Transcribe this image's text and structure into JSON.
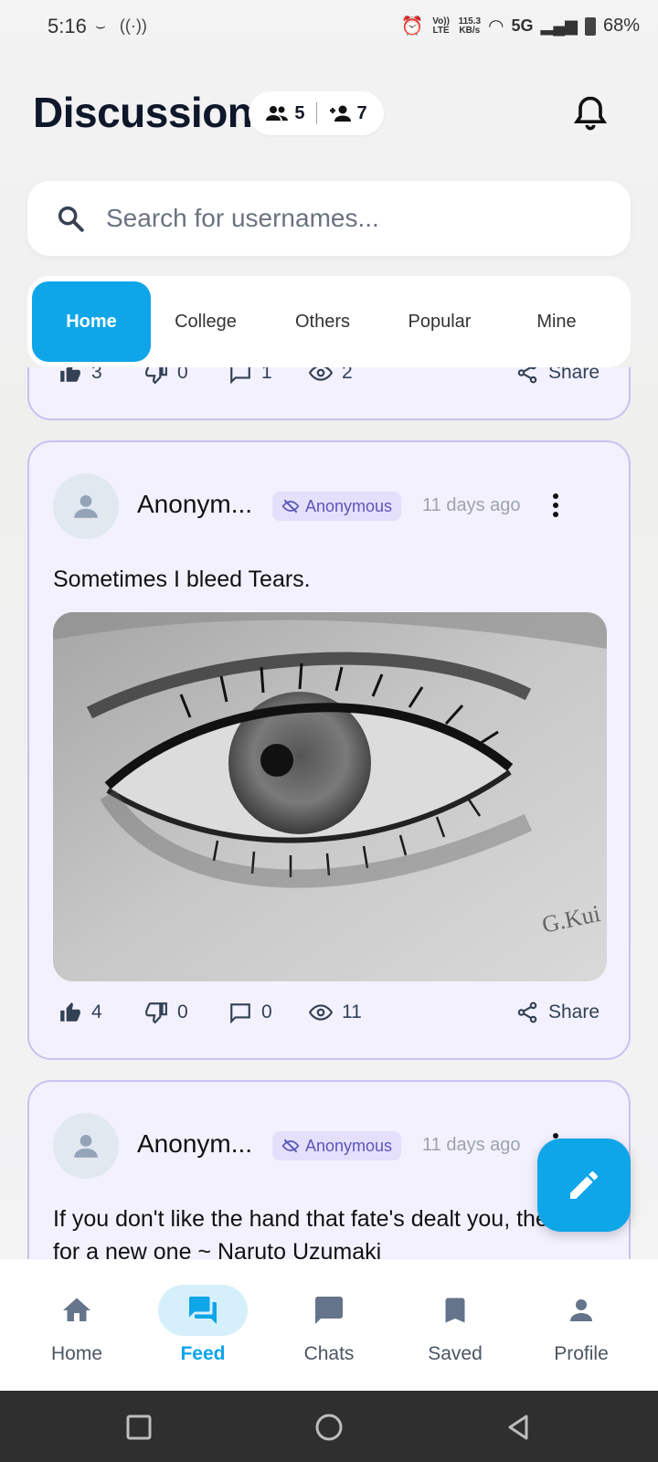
{
  "status_bar": {
    "time": "5:16",
    "network_speed_value": "115.3",
    "network_speed_unit": "KB/s",
    "volte": "Vo)) LTE",
    "network_type": "5G",
    "battery": "68%"
  },
  "header": {
    "title": "Discussion",
    "members_count": "5",
    "friends_count": "7"
  },
  "search": {
    "placeholder": "Search for usernames..."
  },
  "tabs": [
    {
      "label": "Home",
      "active": true
    },
    {
      "label": "College",
      "active": false
    },
    {
      "label": "Others",
      "active": false
    },
    {
      "label": "Popular",
      "active": false
    },
    {
      "label": "Mine",
      "active": false
    }
  ],
  "posts": [
    {
      "likes": "3",
      "dislikes": "0",
      "comments": "1",
      "views": "2",
      "share_label": "Share"
    },
    {
      "username": "Anonym...",
      "badge": "Anonymous",
      "time": "11 days ago",
      "text": "Sometimes I bleed Tears.",
      "likes": "4",
      "dislikes": "0",
      "comments": "0",
      "views": "11",
      "share_label": "Share"
    },
    {
      "username": "Anonym...",
      "badge": "Anonymous",
      "time": "11 days ago",
      "text": "If you don't like the hand that fate's dealt you, then fight for a new one ~ Naruto Uzumaki"
    }
  ],
  "bottom_nav": [
    {
      "label": "Home",
      "icon": "home-icon",
      "active": false
    },
    {
      "label": "Feed",
      "icon": "forum-icon",
      "active": true
    },
    {
      "label": "Chats",
      "icon": "chat-icon",
      "active": false
    },
    {
      "label": "Saved",
      "icon": "bookmark-icon",
      "active": false
    },
    {
      "label": "Profile",
      "icon": "person-icon",
      "active": false
    }
  ],
  "colors": {
    "accent": "#0ea5e9",
    "card_bg": "#f3f1fe",
    "card_border": "#c9c1f0",
    "badge_text": "#5b55b8"
  }
}
